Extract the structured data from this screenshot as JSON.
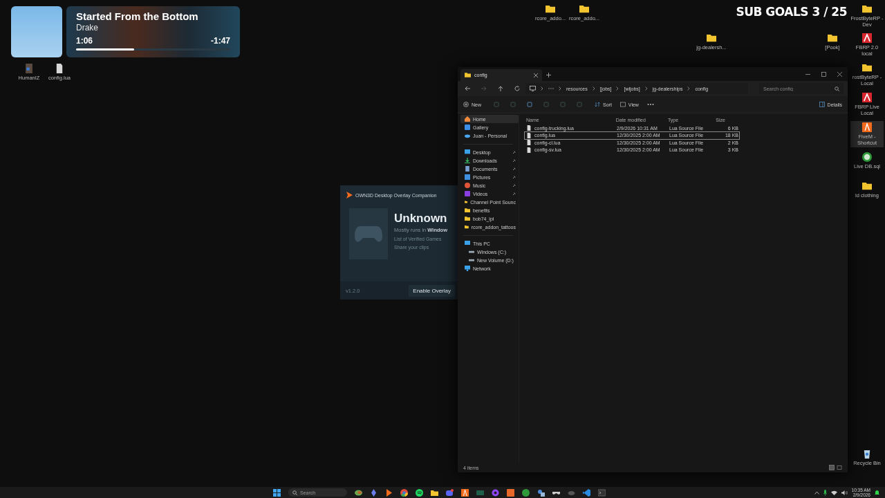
{
  "now_playing": {
    "title": "Started From the Bottom",
    "artist": "Drake",
    "elapsed": "1:06",
    "remaining": "-1:47",
    "level": 0.376
  },
  "sub_goals": "SUB GOALS 3 / 25",
  "desktop_icons": [
    {
      "kind": "file-photo",
      "label": "HumanIZ"
    },
    {
      "kind": "file",
      "label": "config.lua"
    },
    {
      "kind": "folder",
      "label": "rcore_addo..."
    },
    {
      "kind": "folder",
      "label": "rcore_addo..."
    },
    {
      "kind": "folder",
      "label": "jg-dealersh..."
    },
    {
      "kind": "folder",
      "label": "[Pook]"
    },
    {
      "kind": "folder",
      "label": "FrostByteRP - Dev"
    },
    {
      "kind": "app-red",
      "label": "FBRP 2.0 local"
    },
    {
      "kind": "folder",
      "label": "rostByteRP - Local"
    },
    {
      "kind": "app-red",
      "label": "FBRP Live Local"
    },
    {
      "kind": "app-orange",
      "label": "FiveM - Shortcut",
      "selected": true
    },
    {
      "kind": "database",
      "label": "Live DB.sql"
    },
    {
      "kind": "folder",
      "label": "ld clothing"
    },
    {
      "kind": "recycle",
      "label": "Recycle Bin"
    }
  ],
  "overlay_window": {
    "title": "OWN3D Desktop Overlay Companion",
    "heading": "Unknown",
    "subtitle": "Mostly runs in **Window**",
    "links": [
      "List of Verified Games",
      "Share your clips"
    ],
    "version": "v1.2.0",
    "button": "Enable Overlay"
  },
  "explorer": {
    "tabs": [
      {
        "label": "config",
        "selected": true
      }
    ],
    "breadcrumb": [
      "resources",
      "[jobs]",
      "[wljobs]",
      "jg-dealerships",
      "config"
    ],
    "search": {
      "placeholder": "Search config"
    },
    "toolbar": {
      "new": "New",
      "sort": "Sort",
      "view": "View",
      "details": "Details"
    },
    "sidebar": [
      [
        {
          "kind": "home",
          "label": "Home",
          "selected": true
        },
        {
          "kind": "gallery",
          "label": "Gallery",
          "selected": false
        },
        {
          "kind": "cloud",
          "label": "Juan - Personal",
          "selected": false
        }
      ],
      [
        {
          "kind": "desktop",
          "label": "Desktop",
          "selected": false,
          "pinned": true
        },
        {
          "kind": "download",
          "label": "Downloads",
          "selected": false,
          "pinned": true
        },
        {
          "kind": "document",
          "label": "Documents",
          "selected": false,
          "pinned": true
        },
        {
          "kind": "picture",
          "label": "Pictures",
          "selected": false,
          "pinned": true
        },
        {
          "kind": "music",
          "label": "Music",
          "selected": false,
          "pinned": true
        },
        {
          "kind": "video",
          "label": "Videos",
          "selected": false,
          "pinned": true
        },
        {
          "kind": "folder",
          "label": "Channel Point Sounc",
          "selected": false,
          "pinned": false
        },
        {
          "kind": "folder",
          "label": "benefits",
          "selected": false,
          "pinned": false
        },
        {
          "kind": "folder",
          "label": "bob74_ipl",
          "selected": false,
          "pinned": false
        },
        {
          "kind": "folder",
          "label": "rcore_addon_tattoos",
          "selected": false,
          "pinned": false
        }
      ],
      [
        {
          "kind": "pc",
          "label": "This PC",
          "selected": false,
          "children": [
            {
              "kind": "drive",
              "label": "Windows (C:)",
              "selected": false
            },
            {
              "kind": "drive",
              "label": "New Volume (D:)",
              "selected": false
            }
          ]
        },
        {
          "kind": "network",
          "label": "Network",
          "selected": false
        }
      ]
    ],
    "columns": [
      "Name",
      "Date modified",
      "Type",
      "Size"
    ],
    "files": [
      {
        "name": "config-trucking.lua",
        "date": "2/9/2026 10:31 AM",
        "type": "Lua Source File",
        "size": "6 KB",
        "selected": false
      },
      {
        "name": "config.lua",
        "date": "12/30/2025 2:00 AM",
        "type": "Lua Source File",
        "size": "18 KB",
        "selected": true
      },
      {
        "name": "config-cl.lua",
        "date": "12/30/2025 2:00 AM",
        "type": "Lua Source File",
        "size": "2 KB",
        "selected": false
      },
      {
        "name": "config-sv.lua",
        "date": "12/30/2025 2:00 AM",
        "type": "Lua Source File",
        "size": "3 KB",
        "selected": false
      }
    ],
    "status": "4 items"
  },
  "taskbar": {
    "search": {
      "placeholder": "Search"
    },
    "apps": [
      {
        "kind": "widget"
      },
      {
        "kind": "gem"
      },
      {
        "kind": "play"
      },
      {
        "kind": "chrome"
      },
      {
        "kind": "spotify"
      },
      {
        "kind": "folder"
      },
      {
        "kind": "discord"
      },
      {
        "kind": "fivem"
      },
      {
        "kind": "green-box"
      },
      {
        "kind": "purple-circle"
      },
      {
        "kind": "orange-box"
      },
      {
        "kind": "green-circle"
      },
      {
        "kind": "people"
      },
      {
        "kind": "mask"
      },
      {
        "kind": "cloud"
      },
      {
        "kind": "code"
      },
      {
        "kind": "terminal"
      }
    ],
    "time": "10:35 AM",
    "date": "2/9/2026"
  }
}
